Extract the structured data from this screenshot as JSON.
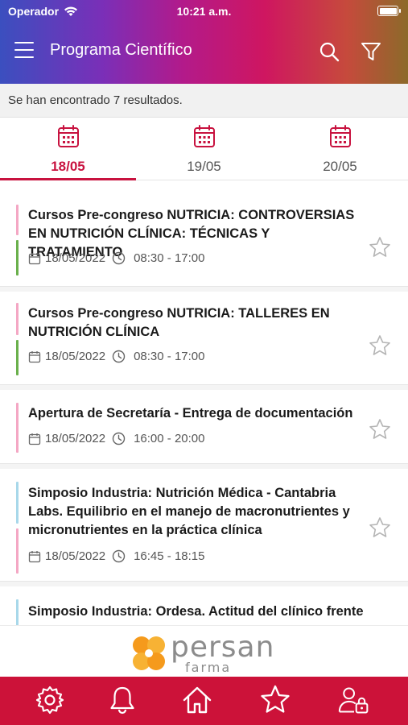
{
  "status_bar": {
    "carrier": "Operador",
    "time": "10:21 a.m."
  },
  "header": {
    "title": "Programa Científico",
    "icons": [
      "menu-icon",
      "search-icon",
      "filter-icon"
    ]
  },
  "results": {
    "text": "Se han encontrado 7 resultados."
  },
  "tabs": [
    {
      "label": "18/05",
      "active": true
    },
    {
      "label": "19/05",
      "active": false
    },
    {
      "label": "20/05",
      "active": false
    }
  ],
  "events": [
    {
      "title_lines": [
        "Cursos Pre-congreso NUTRICIA: CONTROVERSIAS",
        "EN NUTRICIÓN CLÍNICA: TÉCNICAS Y TRATAMIENTO"
      ],
      "date": "18/05/2022",
      "time": "08:30 - 17:00",
      "bar_colors": [
        "#f4a7c4",
        "#6ab04c"
      ]
    },
    {
      "title_lines": [
        "Cursos Pre-congreso NUTRICIA: TALLERES EN",
        "NUTRICIÓN CLÍNICA"
      ],
      "date": "18/05/2022",
      "time": "08:30 - 17:00",
      "bar_colors": [
        "#f4a7c4",
        "#6ab04c"
      ]
    },
    {
      "title_lines": [
        "Apertura de Secretaría - Entrega de documentación"
      ],
      "date": "18/05/2022",
      "time": "16:00 - 20:00",
      "bar_colors": [
        "#f4a7c4"
      ]
    },
    {
      "title_lines": [
        "Simposio Industria: Nutrición Médica - Cantabria",
        "Labs. Equilibrio en el manejo de macronutrientes y",
        "micronutrientes en la práctica clínica"
      ],
      "date": "18/05/2022",
      "time": "16:45 - 18:15",
      "bar_colors": [
        "#a8d8ea",
        "#f4a7c4"
      ]
    },
    {
      "title_lines": [
        "Simposio Industria: Ordesa. Actitud del clínico frente"
      ],
      "date": "",
      "time": "",
      "bar_colors": [
        "#a8d8ea"
      ]
    }
  ],
  "sponsor": {
    "name": "persan",
    "sub": "farma",
    "colors": {
      "orange": "#f59a1c",
      "gray": "#8c8c8c"
    }
  },
  "bottom_nav": {
    "icons": [
      "settings-icon",
      "bell-icon",
      "home-icon",
      "star-icon",
      "user-lock-icon"
    ],
    "color": "#cc1239"
  },
  "colors": {
    "accent": "#c8123f",
    "star_outline": "#b5b5b5"
  }
}
